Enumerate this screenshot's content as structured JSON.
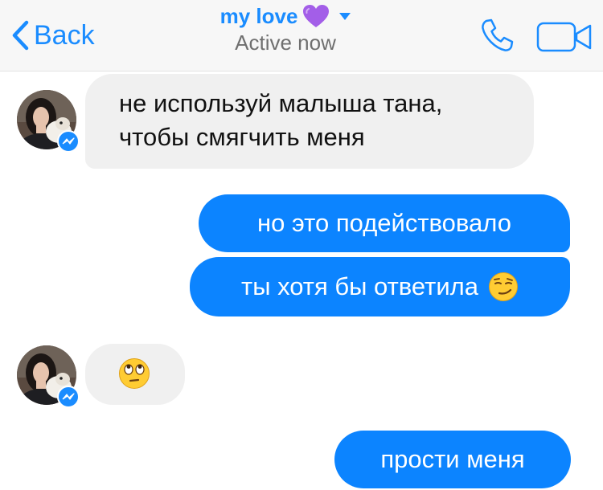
{
  "header": {
    "back_label": "Back",
    "contact_name": "my love",
    "status": "Active now"
  },
  "messages": [
    {
      "direction": "incoming",
      "lines": [
        "не используй малыша тана,",
        "чтобы смягчить меня"
      ]
    },
    {
      "direction": "outgoing",
      "text": "но это подействовало"
    },
    {
      "direction": "outgoing",
      "text": "ты хотя бы ответила",
      "emoji": "smirking-face"
    },
    {
      "direction": "incoming",
      "emoji": "face-with-rolling-eyes"
    },
    {
      "direction": "outgoing",
      "text": "прости меня"
    }
  ],
  "icons": {
    "back": "chevron-left-icon",
    "heart": "purple-heart-icon",
    "caret": "caret-down-icon",
    "call": "phone-icon",
    "video": "video-camera-icon",
    "badge": "messenger-badge-icon"
  },
  "colors": {
    "accent": "#1a8cff",
    "outgoing_bubble": "#0c84ff",
    "incoming_bubble": "#f0f0f0",
    "heart": "#a35ee8",
    "status_text": "#6f6f6f"
  }
}
